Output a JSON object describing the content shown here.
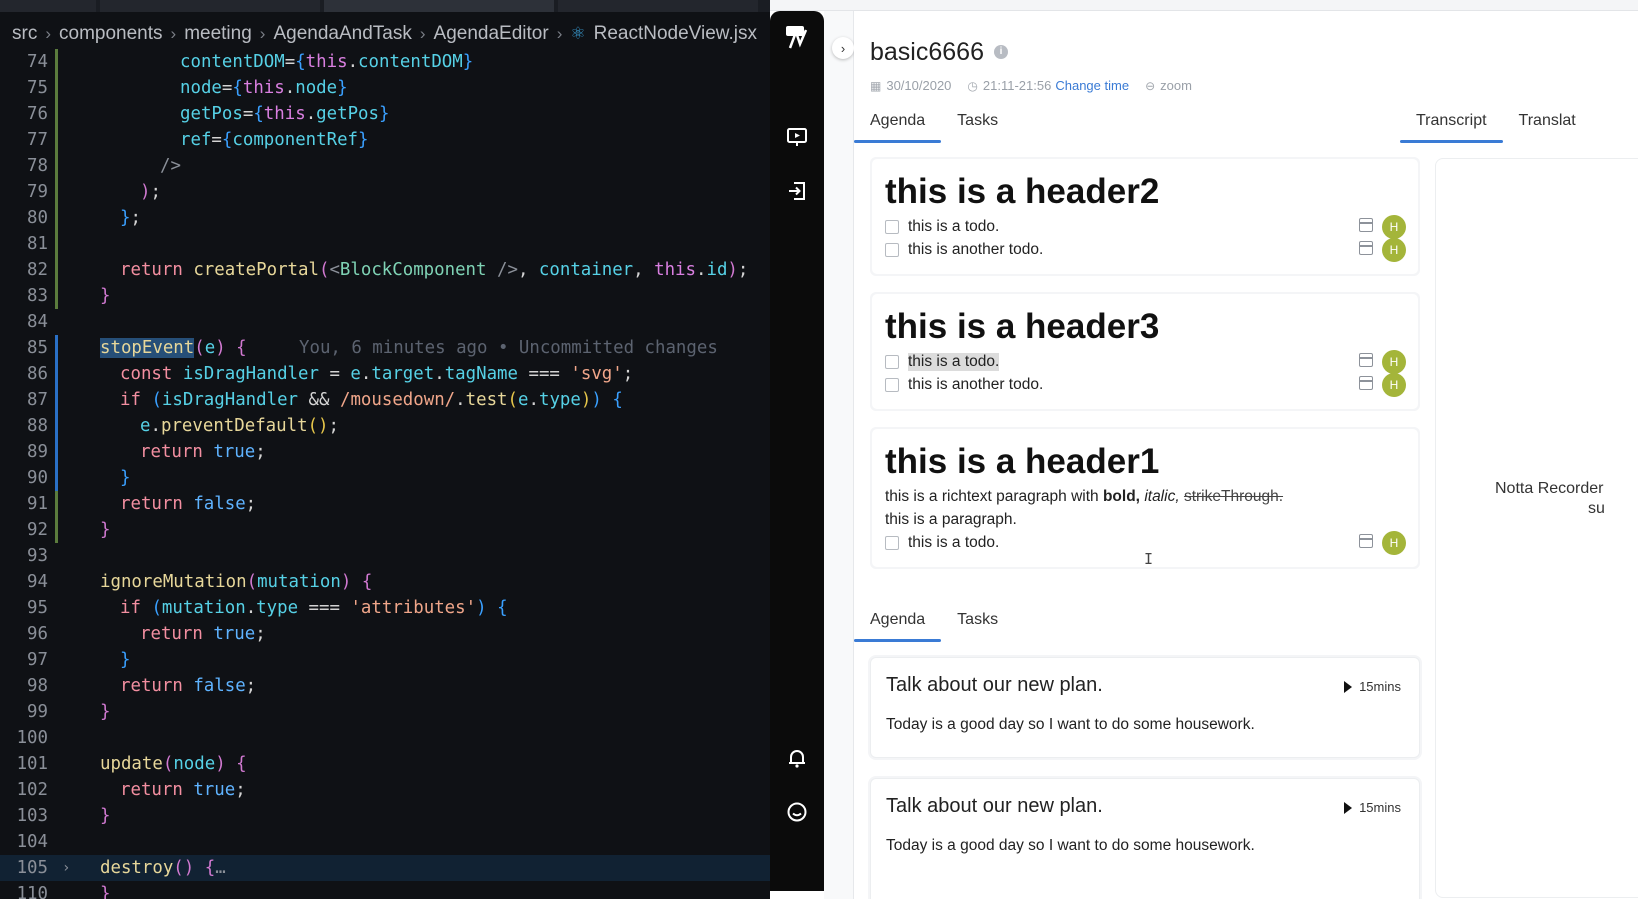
{
  "editor": {
    "breadcrumb": [
      "src",
      "components",
      "meeting",
      "AgendaAndTask",
      "AgendaEditor",
      "ReactNodeView.jsx"
    ],
    "line_numbers": [
      "74",
      "75",
      "76",
      "77",
      "78",
      "79",
      "80",
      "81",
      "82",
      "83",
      "84",
      "85",
      "86",
      "87",
      "88",
      "89",
      "90",
      "91",
      "92",
      "93",
      "94",
      "95",
      "96",
      "97",
      "98",
      "99",
      "100",
      "101",
      "102",
      "103",
      "104",
      "105",
      "110"
    ],
    "blame": "You, 6 minutes ago • Uncommitted changes"
  },
  "app": {
    "title": "basic6666",
    "meta": {
      "date": "30/10/2020",
      "time": "21:11-21:56",
      "change_time": "Change time",
      "platform": "zoom"
    },
    "tabs_top": [
      "Agenda",
      "Tasks"
    ],
    "tabs_right": [
      "Transcript",
      "Translat"
    ],
    "recorder_line1": "Notta Recorder",
    "recorder_line2": "su",
    "cards": [
      {
        "header": "this is a header2",
        "todos": [
          {
            "text": "this is a todo.",
            "avatar": "H"
          },
          {
            "text": "this is another todo.",
            "avatar": "H"
          }
        ]
      },
      {
        "header": "this is a header3",
        "todos": [
          {
            "text": "this is a todo.",
            "avatar": "H"
          },
          {
            "text": "this is another todo.",
            "avatar": "H"
          }
        ]
      },
      {
        "header": "this is a header1",
        "rich": {
          "prefix": "this is a richtext paragraph with ",
          "bold": "bold,",
          "italic": "italic,",
          "strike": "strikeThrough."
        },
        "paragraph": "this is a paragraph.",
        "todos": [
          {
            "text": "this is a todo.",
            "avatar": "H"
          }
        ]
      }
    ],
    "tabs_bottom": [
      "Agenda",
      "Tasks"
    ],
    "agenda_items": [
      {
        "title": "Talk about our new plan.",
        "duration": "15mins",
        "description": "Today is a good day so I want to do some housework."
      },
      {
        "title": "Talk about our new plan.",
        "duration": "15mins",
        "description": "Today is a good day so I want to do some housework."
      }
    ],
    "icons": [
      "notta-logo-icon",
      "presentation-icon",
      "logout-icon",
      "bell-icon",
      "smile-icon",
      "chevron-right-icon",
      "calendar-icon",
      "clock-icon",
      "zoom-icon",
      "info-icon",
      "play-icon"
    ]
  }
}
